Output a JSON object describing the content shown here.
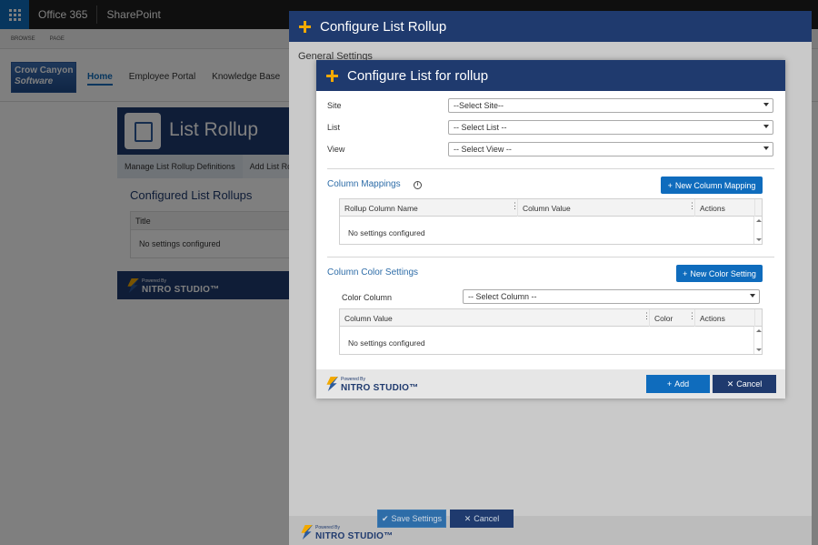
{
  "topbar": {
    "app": "Office 365",
    "product": "SharePoint"
  },
  "ribbon": {
    "tabs": [
      "BROWSE",
      "PAGE"
    ]
  },
  "site": {
    "logo_line1": "Crow Canyon",
    "logo_line2": "Software",
    "nav": [
      "Home",
      "Employee Portal",
      "Knowledge Base"
    ]
  },
  "list_rollup": {
    "title": "List Rollup",
    "tabs": [
      "Manage List Rollup Definitions",
      "Add List Ro"
    ],
    "configured_title": "Configured List Rollups",
    "col_title": "Title",
    "empty": "No settings configured"
  },
  "nitro": {
    "powered_by": "Powered By",
    "name": "NITRO STUDIO™"
  },
  "outer_dialog": {
    "title": "Configure List Rollup",
    "general_settings": "General Settings",
    "save_label": "Save Settings",
    "cancel_label": "Cancel"
  },
  "inner_dialog": {
    "title": "Configure List for rollup",
    "fields": {
      "site_label": "Site",
      "site_value": "--Select Site--",
      "list_label": "List",
      "list_value": "-- Select List --",
      "view_label": "View",
      "view_value": "-- Select View --"
    },
    "column_mappings": {
      "title": "Column Mappings",
      "add_button": "New Column Mapping",
      "headers": [
        "Rollup Column Name",
        "Column Value",
        "Actions"
      ],
      "empty": "No settings configured"
    },
    "color_settings": {
      "title": "Column Color Settings",
      "add_button": "New Color Setting",
      "color_column_label": "Color Column",
      "color_column_value": "-- Select Column --",
      "headers": [
        "Column Value",
        "Color",
        "Actions"
      ],
      "empty": "No settings configured"
    },
    "add_label": "Add",
    "cancel_label": "Cancel"
  }
}
